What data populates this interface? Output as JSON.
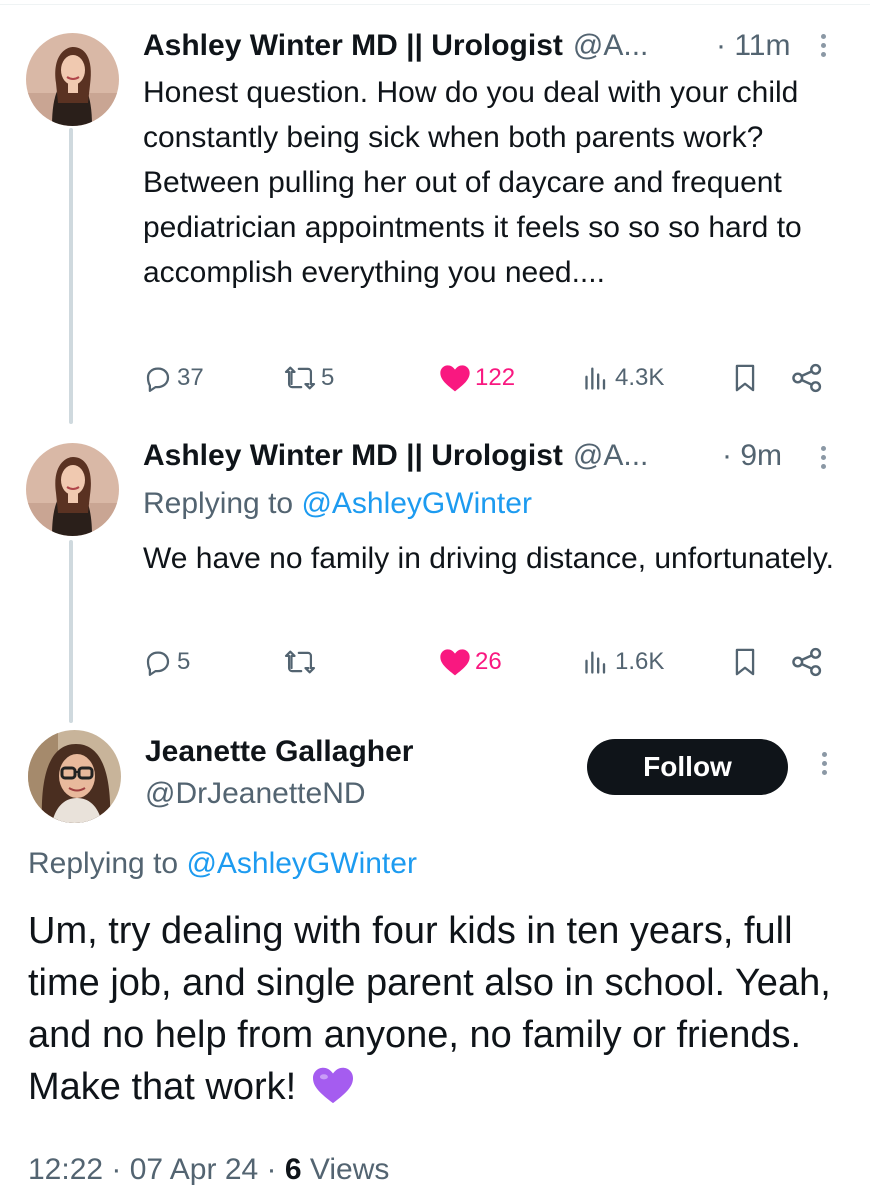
{
  "tweets": [
    {
      "author_name": "Ashley Winter MD || Urologist",
      "author_handle": "@A...",
      "time": "· 11m",
      "text": "Honest question. How do you deal with your child constantly being sick when both parents work? Between pulling her out of daycare and frequent pediatrician appointments it feels so so so hard to accomplish everything you need....",
      "replies": "37",
      "retweets": "5",
      "likes": "122",
      "views": "4.3K",
      "liked": true
    },
    {
      "author_name": "Ashley Winter MD || Urologist",
      "author_handle": "@A...",
      "time": "· 9m",
      "replying_label": "Replying to",
      "replying_handle": "@AshleyGWinter",
      "text": "We have no family in driving distance, unfortunately.",
      "replies": "5",
      "retweets": "",
      "likes": "26",
      "views": "1.6K",
      "liked": true
    }
  ],
  "main_tweet": {
    "author_name": "Jeanette Gallagher",
    "author_handle": "@DrJeanetteND",
    "follow_label": "Follow",
    "replying_label": "Replying to",
    "replying_handle": "@AshleyGWinter",
    "text": "Um, try dealing with four kids in ten years, full time job, and single parent also in school. Yeah, and no help from anyone, no family or friends. Make that work!",
    "emoji": "purple-heart-emoji",
    "time": "12:22",
    "date": "07 Apr 24",
    "views_count": "6",
    "views_label": "Views"
  },
  "icons": [
    "reply-icon",
    "retweet-icon",
    "like-icon",
    "views-icon",
    "bookmark-icon",
    "share-icon",
    "more-icon"
  ],
  "colors": {
    "like": "#f91880",
    "link": "#1d9bf0",
    "secondary_text": "#536471",
    "follow_bg": "#0f1419"
  }
}
